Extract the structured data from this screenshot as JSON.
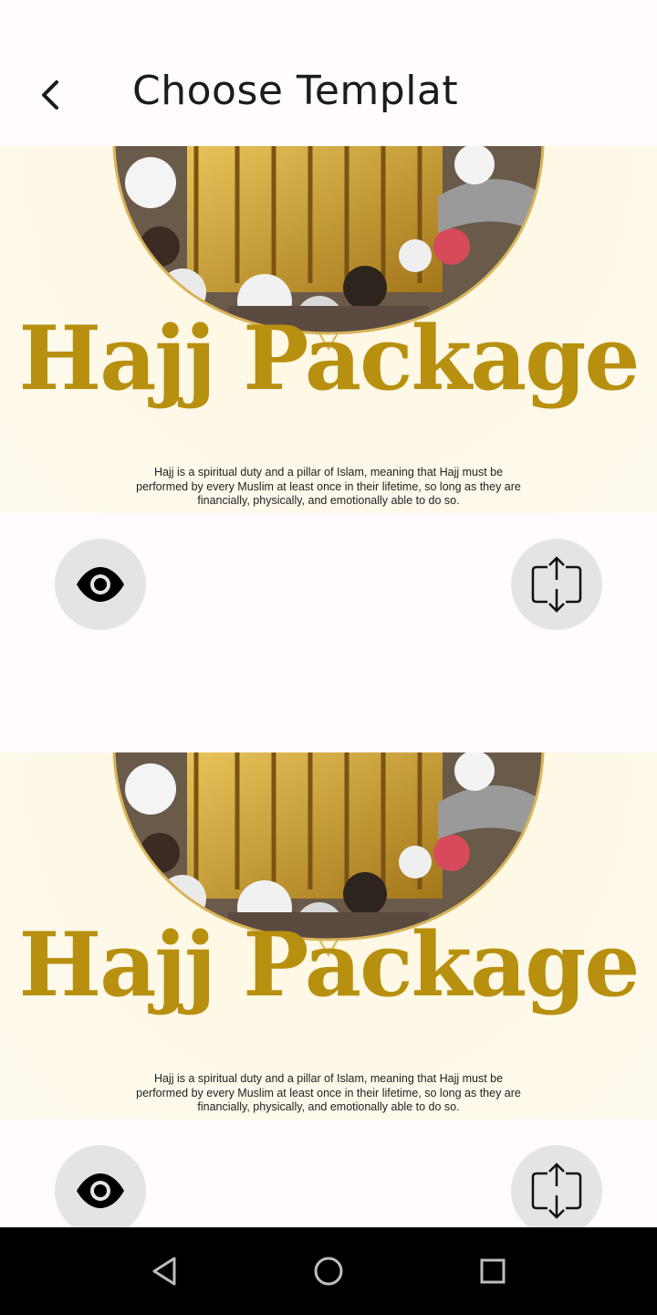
{
  "app_bar": {
    "title": "Choose Templat",
    "back_icon": "chevron-left-icon"
  },
  "templates": [
    {
      "headline": "Hajj Package",
      "description": "Hajj is a spiritual duty and a pillar of Islam, meaning that Hajj must be performed by every Muslim at least once in their lifetime, so long as they are financially, physically, and emotionally able to do so.",
      "preview_icon": "eye-icon",
      "resize_icon": "expand-arrows-icon"
    },
    {
      "headline": "Hajj Package",
      "description": "Hajj is a spiritual duty and a pillar of Islam, meaning that Hajj must be performed by every Muslim at least once in their lifetime, so long as they are financially, physically, and emotionally able to do so.",
      "preview_icon": "eye-icon",
      "resize_icon": "expand-arrows-icon"
    }
  ],
  "colors": {
    "headline_gold": "#b8900f",
    "background": "#fffbfe",
    "button_bg": "#e5e3e6"
  },
  "nav": {
    "back": "triangle-back-icon",
    "home": "circle-home-icon",
    "recents": "square-recents-icon"
  }
}
